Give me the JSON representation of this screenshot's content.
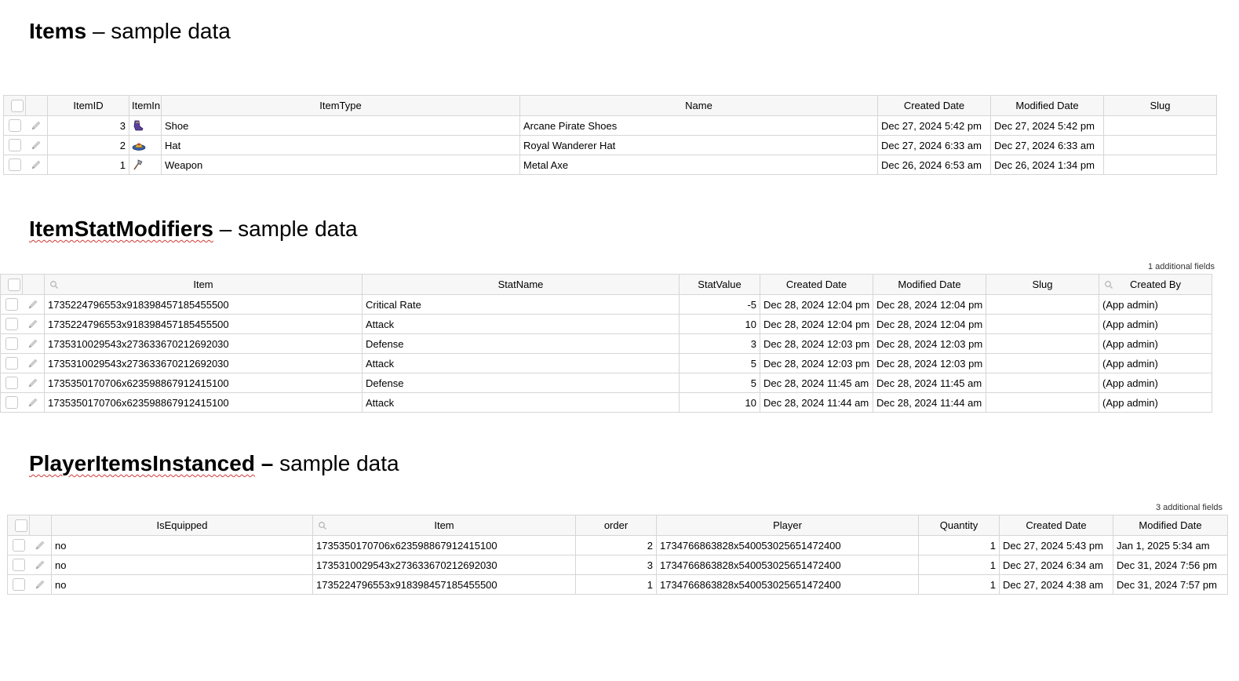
{
  "sections": {
    "items": {
      "title": "Items",
      "suffix": "– sample data",
      "columns": [
        "ItemID",
        "ItemIn",
        "ItemType",
        "Name",
        "Created Date",
        "Modified Date",
        "Slug"
      ],
      "rows": [
        {
          "id": "3",
          "icon": "pirate-shoe-icon",
          "type": "Shoe",
          "name": "Arcane Pirate Shoes",
          "created": "Dec 27, 2024 5:42 pm",
          "modified": "Dec 27, 2024 5:42 pm",
          "slug": ""
        },
        {
          "id": "2",
          "icon": "wanderer-hat-icon",
          "type": "Hat",
          "name": "Royal Wanderer Hat",
          "created": "Dec 27, 2024 6:33 am",
          "modified": "Dec 27, 2024 6:33 am",
          "slug": ""
        },
        {
          "id": "1",
          "icon": "metal-axe-icon",
          "type": "Weapon",
          "name": "Metal Axe",
          "created": "Dec 26, 2024 6:53 am",
          "modified": "Dec 26, 2024 1:34 pm",
          "slug": ""
        }
      ]
    },
    "stat_modifiers": {
      "title": "ItemStatModifiers",
      "suffix": "– sample data",
      "additional_fields": "1 additional fields",
      "columns": [
        "Item",
        "StatName",
        "StatValue",
        "Created Date",
        "Modified Date",
        "Slug",
        "Created By"
      ],
      "rows": [
        {
          "item": "1735224796553x918398457185455500",
          "stat": "Critical Rate",
          "value": "-5",
          "created": "Dec 28, 2024 12:04 pm",
          "modified": "Dec 28, 2024 12:04 pm",
          "slug": "",
          "by": "(App admin)"
        },
        {
          "item": "1735224796553x918398457185455500",
          "stat": "Attack",
          "value": "10",
          "created": "Dec 28, 2024 12:04 pm",
          "modified": "Dec 28, 2024 12:04 pm",
          "slug": "",
          "by": "(App admin)"
        },
        {
          "item": "1735310029543x273633670212692030",
          "stat": "Defense",
          "value": "3",
          "created": "Dec 28, 2024 12:03 pm",
          "modified": "Dec 28, 2024 12:03 pm",
          "slug": "",
          "by": "(App admin)"
        },
        {
          "item": "1735310029543x273633670212692030",
          "stat": "Attack",
          "value": "5",
          "created": "Dec 28, 2024 12:03 pm",
          "modified": "Dec 28, 2024 12:03 pm",
          "slug": "",
          "by": "(App admin)"
        },
        {
          "item": "1735350170706x623598867912415100",
          "stat": "Defense",
          "value": "5",
          "created": "Dec 28, 2024 11:45 am",
          "modified": "Dec 28, 2024 11:45 am",
          "slug": "",
          "by": "(App admin)"
        },
        {
          "item": "1735350170706x623598867912415100",
          "stat": "Attack",
          "value": "10",
          "created": "Dec 28, 2024 11:44 am",
          "modified": "Dec 28, 2024 11:44 am",
          "slug": "",
          "by": "(App admin)"
        }
      ]
    },
    "player_items": {
      "title": "PlayerItemsInstanced",
      "suffix": "sample data",
      "dash": "–",
      "additional_fields": "3 additional fields",
      "columns": [
        "IsEquipped",
        "Item",
        "order",
        "Player",
        "Quantity",
        "Created Date",
        "Modified Date"
      ],
      "rows": [
        {
          "equipped": "no",
          "item": "1735350170706x623598867912415100",
          "order": "2",
          "player": "1734766863828x540053025651472400",
          "qty": "1",
          "created": "Dec 27, 2024 5:43 pm",
          "modified": "Jan 1, 2025 5:34 am"
        },
        {
          "equipped": "no",
          "item": "1735310029543x273633670212692030",
          "order": "3",
          "player": "1734766863828x540053025651472400",
          "qty": "1",
          "created": "Dec 27, 2024 6:34 am",
          "modified": "Dec 31, 2024 7:56 pm"
        },
        {
          "equipped": "no",
          "item": "1735224796553x918398457185455500",
          "order": "1",
          "player": "1734766863828x540053025651472400",
          "qty": "1",
          "created": "Dec 27, 2024 4:38 am",
          "modified": "Dec 31, 2024 7:57 pm"
        }
      ]
    }
  }
}
